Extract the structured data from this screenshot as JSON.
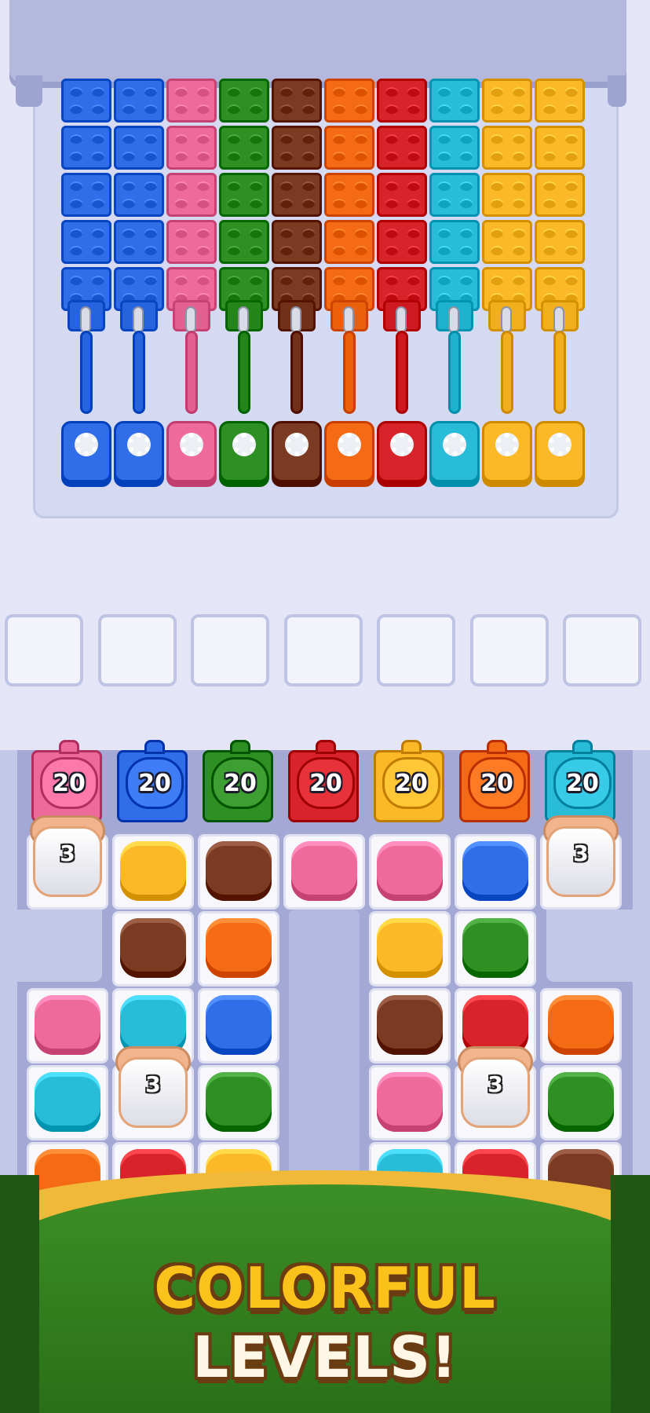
{
  "game": {
    "colors": {
      "blue": "#2f6ee8",
      "pink": "#ee6a9a",
      "green": "#2e8f23",
      "brown": "#7a3b22",
      "orange": "#f56b15",
      "red": "#d8232b",
      "cyan": "#29bcd8",
      "yellow": "#fbb827"
    },
    "dispenser_columns": [
      "blue",
      "blue",
      "pink",
      "green",
      "brown",
      "orange",
      "red",
      "cyan",
      "yellow",
      "yellow"
    ],
    "holding_slots": {
      "count": 7,
      "filled": 0
    },
    "tanks": [
      {
        "color": "pink",
        "count": "20"
      },
      {
        "color": "blue",
        "count": "20"
      },
      {
        "color": "green",
        "count": "20"
      },
      {
        "color": "red",
        "count": "20"
      },
      {
        "color": "yellow",
        "count": "20"
      },
      {
        "color": "orange",
        "count": "20"
      },
      {
        "color": "cyan",
        "count": "20"
      }
    ],
    "mystery_boxes": [
      {
        "label": "3"
      },
      {
        "label": "3"
      },
      {
        "label": "3"
      },
      {
        "label": "3"
      }
    ],
    "board_rows": [
      [
        "mystery",
        "yellow",
        "brown",
        "pink",
        "pink",
        "blue",
        "mystery"
      ],
      [
        "",
        "brown",
        "orange",
        "",
        "yellow",
        "green",
        ""
      ],
      [
        "pink",
        "cyan",
        "blue",
        "",
        "brown",
        "red",
        "orange"
      ],
      [
        "cyan",
        "mystery",
        "green",
        "",
        "pink",
        "mystery",
        "green"
      ],
      [
        "orange",
        "red",
        "yellow",
        "",
        "cyan",
        "red",
        "brown"
      ]
    ]
  },
  "banner": {
    "line1": "COLORFUL",
    "line2": "LEVELS!",
    "colors": {
      "line1": "#fcc21c",
      "line2": "#fff7e6",
      "outline": "#6b3b12",
      "ribbon": "#2f7d1d",
      "ribbon_edge": "#f0b93a"
    }
  }
}
